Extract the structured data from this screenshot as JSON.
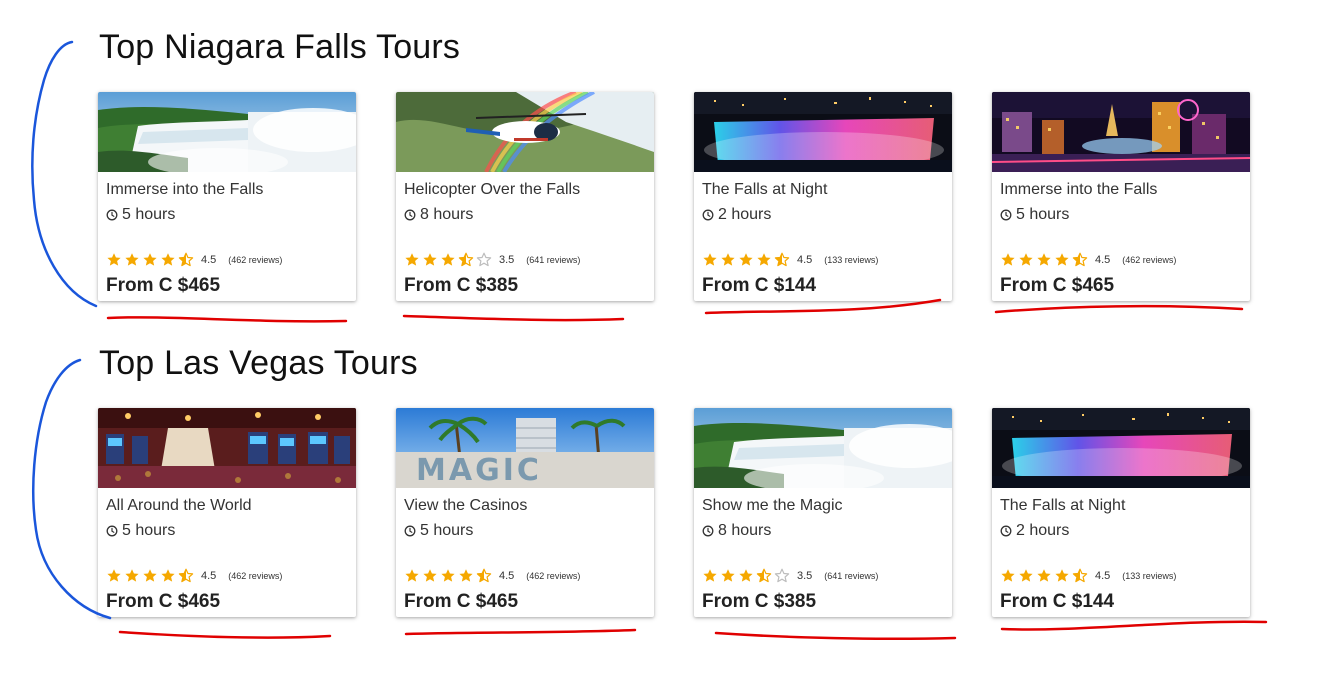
{
  "sections": [
    {
      "title": "Top Niagara Falls Tours",
      "tours": [
        {
          "title": "Immerse into the Falls",
          "duration": "5 hours",
          "rating": "4.5",
          "stars": 4.5,
          "reviews": "(462 reviews)",
          "price": "From C $465",
          "image": "waterfall-day-photo"
        },
        {
          "title": "Helicopter Over the Falls",
          "duration": "8 hours",
          "rating": "3.5",
          "stars": 3.5,
          "reviews": "(641 reviews)",
          "price": "From C $385",
          "image": "helicopter-rainbow-photo"
        },
        {
          "title": "The Falls at Night",
          "duration": "2 hours",
          "rating": "4.5",
          "stars": 4.5,
          "reviews": "(133 reviews)",
          "price": "From C $144",
          "image": "falls-night-lights-photo"
        },
        {
          "title": "Immerse into the Falls",
          "duration": "5 hours",
          "rating": "4.5",
          "stars": 4.5,
          "reviews": "(462 reviews)",
          "price": "From C $465",
          "image": "las-vegas-strip-night-photo"
        }
      ]
    },
    {
      "title": "Top Las Vegas Tours",
      "tours": [
        {
          "title": "All Around the World",
          "duration": "5 hours",
          "rating": "4.5",
          "stars": 4.5,
          "reviews": "(462 reviews)",
          "price": "From C $465",
          "image": "casino-floor-photo"
        },
        {
          "title": "View the Casinos",
          "duration": "5 hours",
          "rating": "4.5",
          "stars": 4.5,
          "reviews": "(462 reviews)",
          "price": "From C $465",
          "image": "magic-sign-palms-photo"
        },
        {
          "title": "Show me the Magic",
          "duration": "8 hours",
          "rating": "3.5",
          "stars": 3.5,
          "reviews": "(641 reviews)",
          "price": "From C $385",
          "image": "waterfall-day-photo"
        },
        {
          "title": "The Falls at Night",
          "duration": "2 hours",
          "rating": "4.5",
          "stars": 4.5,
          "reviews": "(133 reviews)",
          "price": "From C $144",
          "image": "falls-night-lights-photo"
        }
      ]
    }
  ],
  "icons": {
    "clock": "clock-icon",
    "star": "star-icon"
  },
  "colors": {
    "star": "#F5A800",
    "star_empty": "#BDBDBD",
    "annotation_bracket": "#1A56DB",
    "annotation_underline": "#E00000"
  }
}
